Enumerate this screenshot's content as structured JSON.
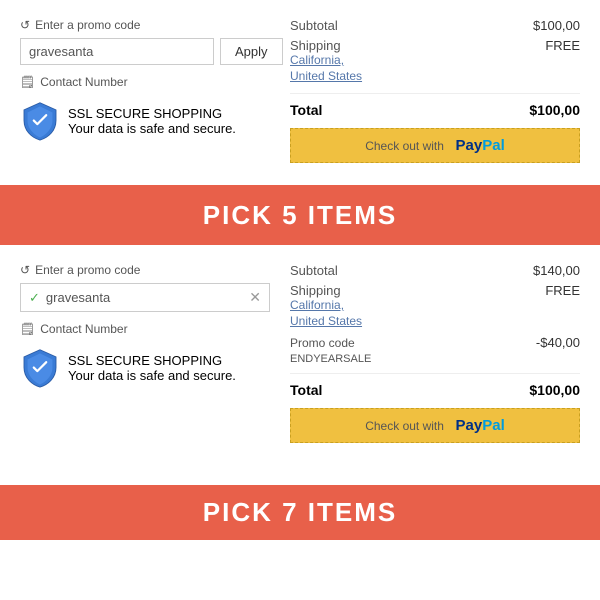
{
  "section1": {
    "promo_label": "Enter a promo code",
    "promo_value": "gravesanta",
    "apply_label": "Apply",
    "contact_label": "Contact Number",
    "ssl_title": "SSL SECURE SHOPPING",
    "ssl_subtitle": "Your data is safe and secure.",
    "subtotal_label": "Subtotal",
    "subtotal_value": "$100,00",
    "shipping_label": "Shipping",
    "shipping_value": "FREE",
    "shipping_location1": "California,",
    "shipping_location2": "United States",
    "total_label": "Total",
    "total_value": "$100,00",
    "paypal_prefix": "Check out with",
    "paypal_logo": "PayPal"
  },
  "banner1": {
    "text": "PICK 5 ITEMS"
  },
  "section2": {
    "promo_label": "Enter a promo code",
    "promo_applied_value": "gravesanta",
    "contact_label": "Contact Number",
    "ssl_title": "SSL SECURE SHOPPING",
    "ssl_subtitle": "Your data is safe and secure.",
    "subtotal_label": "Subtotal",
    "subtotal_value": "$140,00",
    "shipping_label": "Shipping",
    "shipping_value": "FREE",
    "shipping_location1": "California,",
    "shipping_location2": "United States",
    "promo_code_label": "Promo code",
    "promo_code_name": "ENDYEARSALE",
    "promo_discount": "-$40,00",
    "total_label": "Total",
    "total_value": "$100,00",
    "paypal_prefix": "Check out with",
    "paypal_logo": "PayPal"
  },
  "banner2": {
    "text": "PICK 7 ITEMS"
  }
}
